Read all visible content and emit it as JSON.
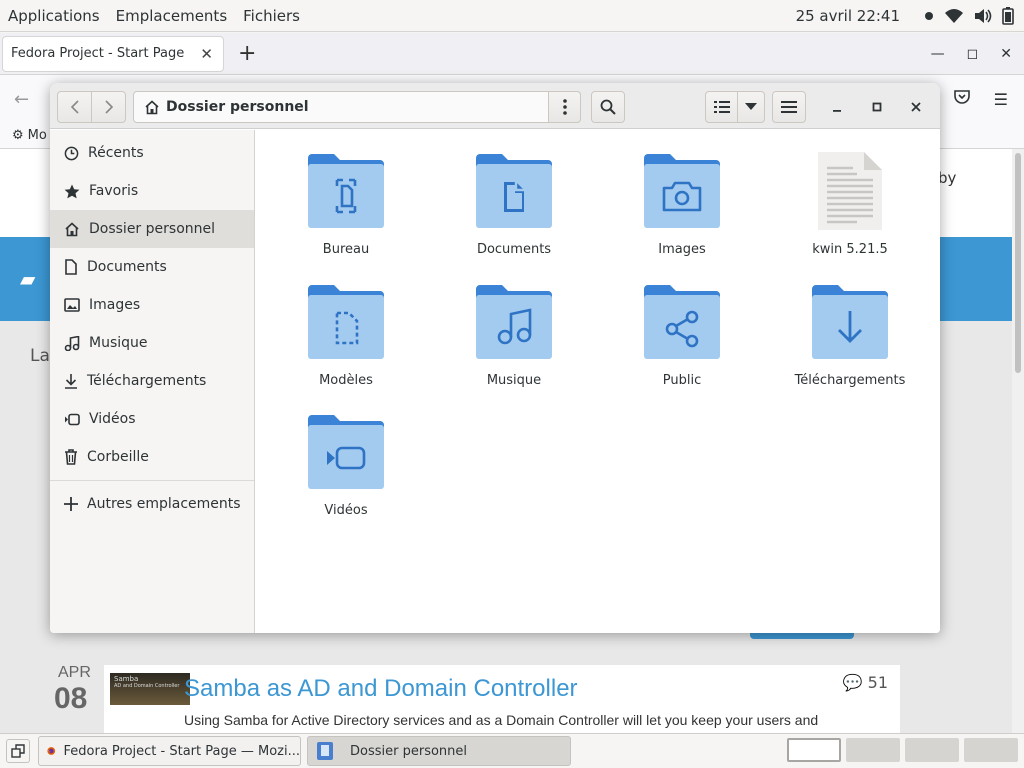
{
  "topbar": {
    "menus": [
      "Applications",
      "Emplacements",
      "Fichiers"
    ],
    "clock": "25 avril  22:41"
  },
  "firefox": {
    "tab_title": "Fedora Project - Start Page",
    "bookmark_label": "Mo",
    "page": {
      "partial_text_right": "by",
      "partial_text_left": "La",
      "post": {
        "month": "APR",
        "day": "08",
        "thumb_title": "Samba",
        "thumb_sub": "AD and Domain Controller",
        "title": "Samba as AD and Domain Controller",
        "excerpt": "Using Samba for Active Directory services and as a Domain Controller will let you keep your users and",
        "comments": "51"
      }
    }
  },
  "nautilus": {
    "path": "Dossier personnel",
    "sidebar": [
      {
        "label": "Récents",
        "icon": "clock-icon"
      },
      {
        "label": "Favoris",
        "icon": "star-icon"
      },
      {
        "label": "Dossier personnel",
        "icon": "home-icon",
        "active": true
      },
      {
        "label": "Documents",
        "icon": "document-icon"
      },
      {
        "label": "Images",
        "icon": "image-icon"
      },
      {
        "label": "Musique",
        "icon": "music-icon"
      },
      {
        "label": "Téléchargements",
        "icon": "download-icon"
      },
      {
        "label": "Vidéos",
        "icon": "video-icon"
      },
      {
        "label": "Corbeille",
        "icon": "trash-icon"
      },
      {
        "label": "Autres emplacements",
        "icon": "plus-icon"
      }
    ],
    "items": [
      {
        "label": "Bureau",
        "icon": "desktop-folder-icon"
      },
      {
        "label": "Documents",
        "icon": "documents-folder-icon"
      },
      {
        "label": "Images",
        "icon": "pictures-folder-icon"
      },
      {
        "label": "kwin 5.21.5",
        "icon": "text-file-icon"
      },
      {
        "label": "Modèles",
        "icon": "templates-folder-icon"
      },
      {
        "label": "Musique",
        "icon": "music-folder-icon"
      },
      {
        "label": "Public",
        "icon": "public-folder-icon"
      },
      {
        "label": "Téléchargements",
        "icon": "downloads-folder-icon"
      },
      {
        "label": "Vidéos",
        "icon": "videos-folder-icon"
      }
    ]
  },
  "taskbar": {
    "tasks": [
      "Fedora Project - Start Page — Mozi...",
      "Dossier personnel"
    ]
  },
  "colors": {
    "folder_back": "#3a83d6",
    "folder_front": "#a3cbf0",
    "accent": "#3c97d3"
  }
}
